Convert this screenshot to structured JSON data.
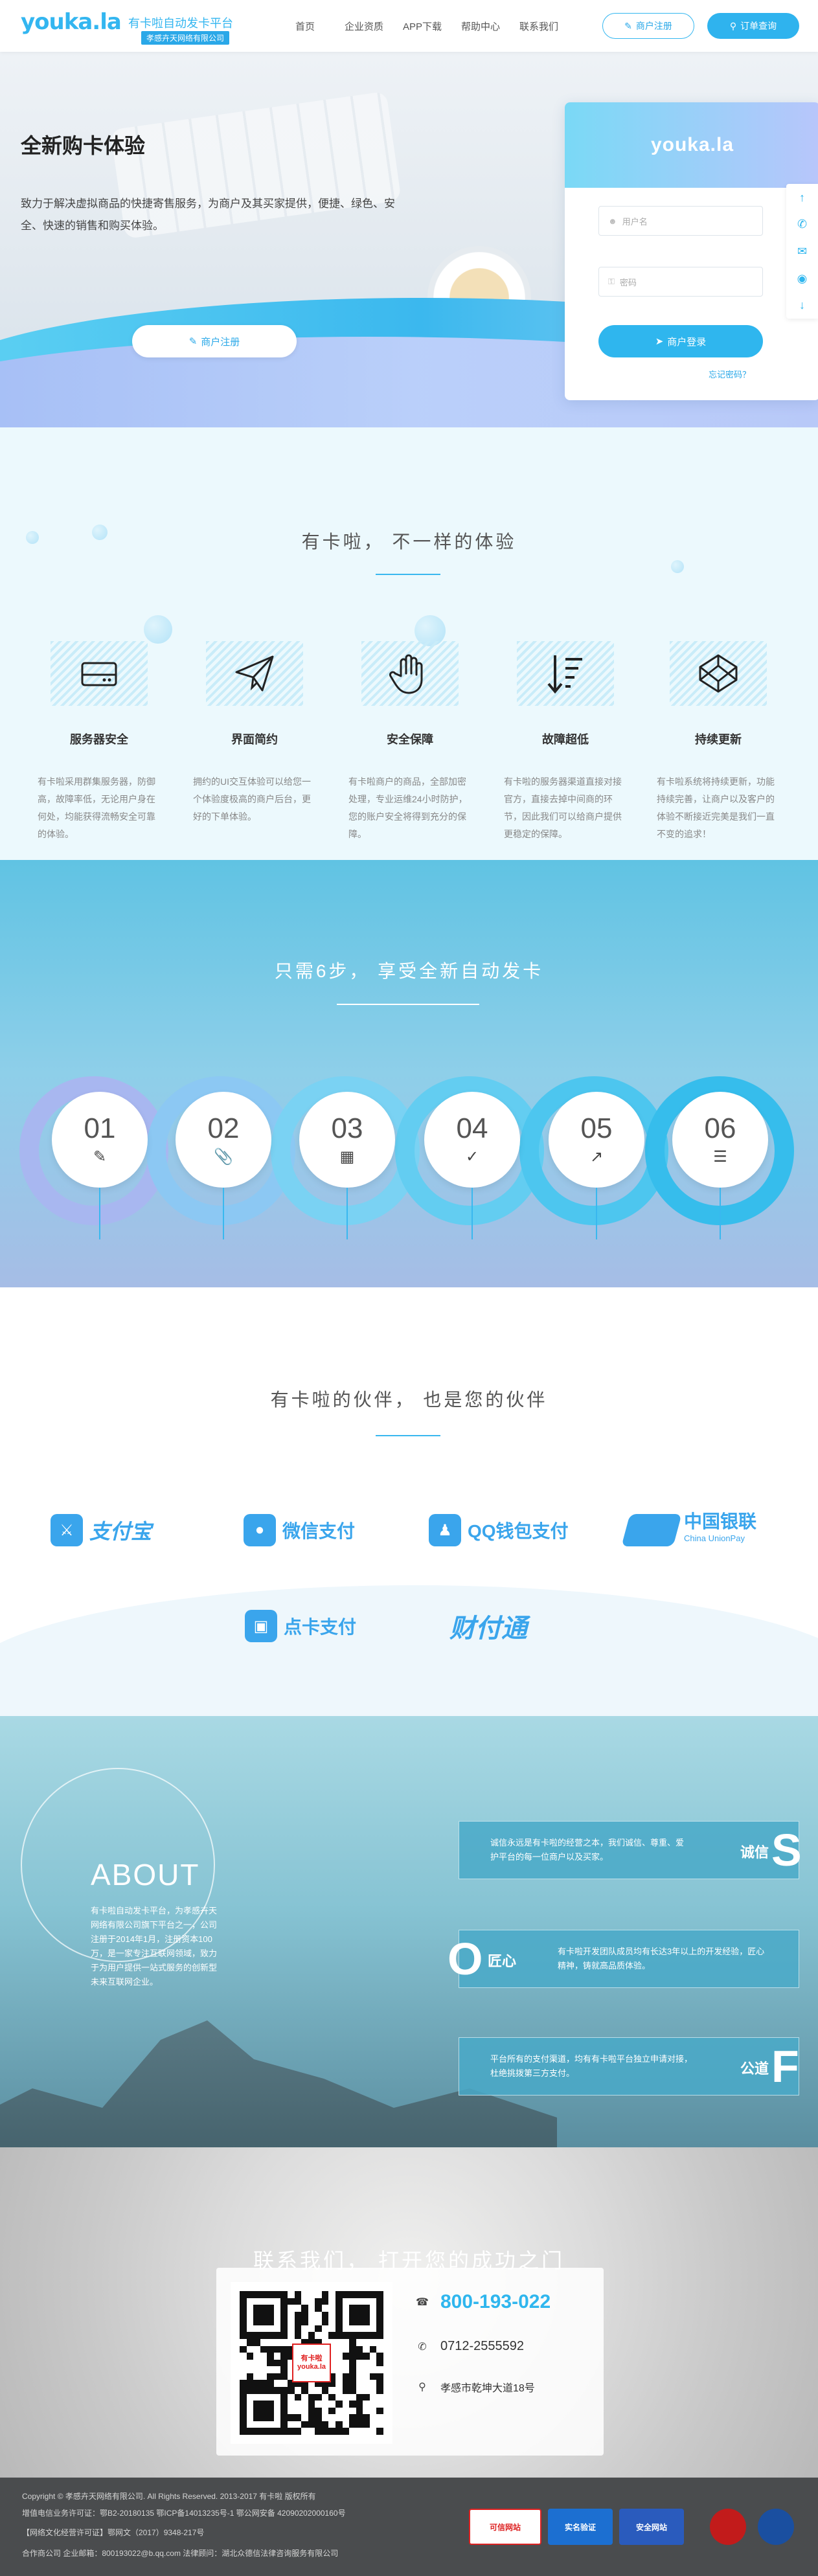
{
  "header": {
    "logo": "youka.la",
    "slogan": "有卡啦自动发卡平台",
    "company": "孝感卉天网络有限公司",
    "nav": [
      "首页",
      "企业资质",
      "APP下载",
      "帮助中心",
      "联系我们"
    ],
    "register_label": "商户注册",
    "query_label": "订单查询"
  },
  "hero": {
    "title": "全新购卡体验",
    "desc": "致力于解决虚拟商品的快捷寄售服务，为商户及其买家提供，便捷、绿色、安全、快速的销售和购买体验。",
    "register_label": "商户注册"
  },
  "login": {
    "brand": "youka.la",
    "username_placeholder": "用户名",
    "password_placeholder": "密码",
    "login_label": "商户登录",
    "forgot_label": "忘记密码？"
  },
  "side_toolbar": [
    "arrow-up-icon",
    "phone-icon",
    "chat-icon",
    "qq-icon",
    "arrow-down-icon"
  ],
  "features": {
    "title": "有卡啦，  不一样的体验",
    "items": [
      {
        "name": "服务器安全",
        "icon": "server-icon",
        "desc": "有卡啦采用群集服务器，防御高，故障率低，无论用户身在何处，均能获得流畅安全可靠的体验。"
      },
      {
        "name": "界面简约",
        "icon": "paper-plane-icon",
        "desc": "拥约的UI交互体验可以给您一个体验度极高的商户后台，更好的下单体验。"
      },
      {
        "name": "安全保障",
        "icon": "hand-icon",
        "desc": "有卡啦商户的商品，全部加密处理，专业运维24小时防护，您的账户安全将得到充分的保障。"
      },
      {
        "name": "故障超低",
        "icon": "sort-down-icon",
        "desc": "有卡啦的服务器渠道直接对接官方，直接去掉中间商的环节，因此我们可以给商户提供更稳定的保障。"
      },
      {
        "name": "持续更新",
        "icon": "codepen-icon",
        "desc": "有卡啦系统将持续更新，功能持续完善，让商户以及客户的体验不断接近完美是我们一直不变的追求！"
      }
    ]
  },
  "steps": {
    "title": "只需6步，  享受全新自动发卡",
    "items": [
      {
        "num": "01",
        "icon": "edit-icon"
      },
      {
        "num": "02",
        "icon": "attach-icon"
      },
      {
        "num": "03",
        "icon": "calendar-icon"
      },
      {
        "num": "04",
        "icon": "check-icon"
      },
      {
        "num": "05",
        "icon": "share-icon"
      },
      {
        "num": "06",
        "icon": "sliders-icon"
      }
    ]
  },
  "partners": {
    "title": "有卡啦的伙伴，  也是您的伙伴",
    "items": [
      {
        "name": "支付宝",
        "icon": "alipay-icon"
      },
      {
        "name": "微信支付",
        "icon": "wechat-pay-icon"
      },
      {
        "name": "QQ钱包支付",
        "icon": "qq-wallet-icon"
      },
      {
        "name": "中国银联",
        "sub": "China UnionPay",
        "icon": "unionpay-icon"
      },
      {
        "name": "点卡支付",
        "icon": "card-pay-icon"
      },
      {
        "name": "财付通",
        "icon": "tenpay-icon"
      }
    ]
  },
  "about": {
    "title": "ABOUT",
    "text": "有卡啦自动发卡平台，为孝感卉天网络有限公司旗下平台之一，公司注册于2014年1月，注册资本100万，是一家专注互联网领域，致力于为用户提供一站式服务的创新型未来互联网企业。",
    "values": [
      {
        "name": "诚信",
        "letter": "S",
        "text": "诚信永远是有卡啦的经营之本，我们诚信、尊重、爱护平台的每一位商户以及买家。"
      },
      {
        "name": "匠心",
        "letter": "O",
        "text": "有卡啦开发团队成员均有长达3年以上的开发经验，匠心精神，铸就高品质体验。"
      },
      {
        "name": "公道",
        "letter": "F",
        "text": "平台所有的支付渠道，均有有卡啦平台独立申请对接，杜绝挑拨第三方支付。"
      }
    ]
  },
  "contact": {
    "title": "联系我们，  打开您的成功之门",
    "qr_label": "有卡啦 youka.la",
    "phone": "800-193-022",
    "tel": "0712-2555592",
    "address": "孝感市乾坤大道18号"
  },
  "footer": {
    "line1": "Copyright © 孝感卉天网络有限公司. All Rights Reserved. 2013-2017 有卡啦 版权所有",
    "line2": "增值电信业务许可证：鄂B2-20180135 鄂ICP备14013235号-1   鄂公网安备 42090202000160号",
    "line3": "【网络文化经营许可证】鄂网文（2017）9348-217号",
    "line4": "合作商公司 企业邮箱：800193022@b.qq.com 法律顾问：湖北众德信法律咨询服务有限公司",
    "badges": [
      "可信网站",
      "实名验证",
      "安全网站",
      "",
      ""
    ]
  },
  "colors": {
    "brand": "#33b6f0",
    "accent": "#2fb6ee",
    "footer_bg": "#4a4c4e"
  }
}
